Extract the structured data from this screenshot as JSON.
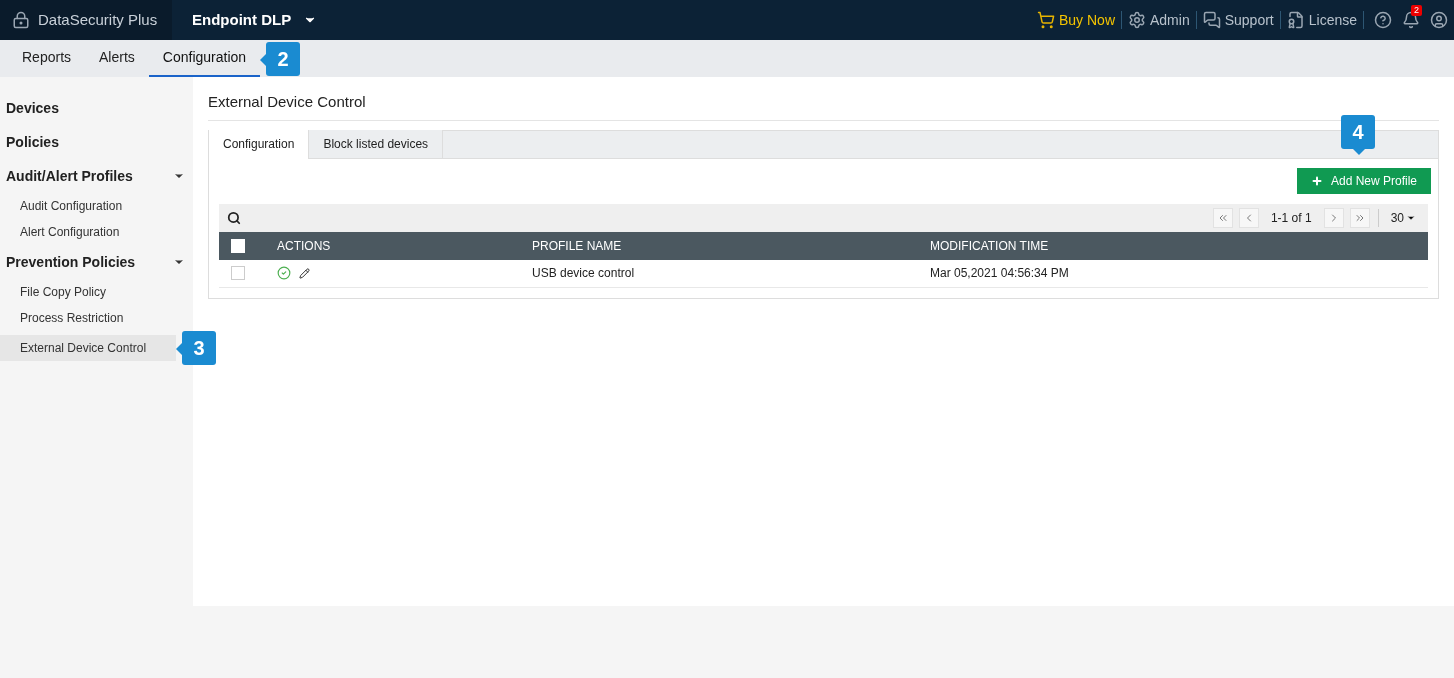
{
  "header": {
    "app_name": "DataSecurity Plus",
    "module": "Endpoint DLP",
    "links": [
      {
        "label": "Buy Now",
        "kind": "cart"
      },
      {
        "label": "Admin",
        "kind": "admin"
      },
      {
        "label": "Support",
        "kind": "support"
      },
      {
        "label": "License",
        "kind": "license"
      }
    ],
    "notification_count": "2"
  },
  "nav_tabs": [
    {
      "label": "Reports",
      "selected": false
    },
    {
      "label": "Alerts",
      "selected": false
    },
    {
      "label": "Configuration",
      "selected": true,
      "callout": "2"
    }
  ],
  "sidebar": [
    {
      "label": "Devices",
      "kind": "link"
    },
    {
      "label": "Policies",
      "kind": "link"
    },
    {
      "label": "Audit/Alert Profiles",
      "kind": "group",
      "expanded": true,
      "children": [
        {
          "label": "Audit Configuration",
          "selected": false
        },
        {
          "label": "Alert Configuration",
          "selected": false
        }
      ]
    },
    {
      "label": "Prevention Policies",
      "kind": "group",
      "expanded": true,
      "children": [
        {
          "label": "File Copy Policy",
          "selected": false
        },
        {
          "label": "Process Restriction",
          "selected": false
        },
        {
          "label": "External Device Control",
          "selected": true,
          "callout": "3"
        }
      ]
    }
  ],
  "page_title": "External Device Control",
  "tabs": [
    {
      "label": "Configuration",
      "selected": true
    },
    {
      "label": "Block listed devices",
      "selected": false
    }
  ],
  "add_button": {
    "label": "Add New Profile",
    "callout": "4"
  },
  "pagination": {
    "range": "1-1 of 1",
    "page_size": "30"
  },
  "table": {
    "select_all_checked": false,
    "columns": [
      "ACTIONS",
      "PROFILE NAME",
      "MODIFICATION TIME"
    ],
    "rows": [
      {
        "checked": false,
        "enabled": true,
        "cells": [
          "",
          "USB device control",
          "Mar 05,2021 04:56:34 PM"
        ]
      }
    ]
  }
}
